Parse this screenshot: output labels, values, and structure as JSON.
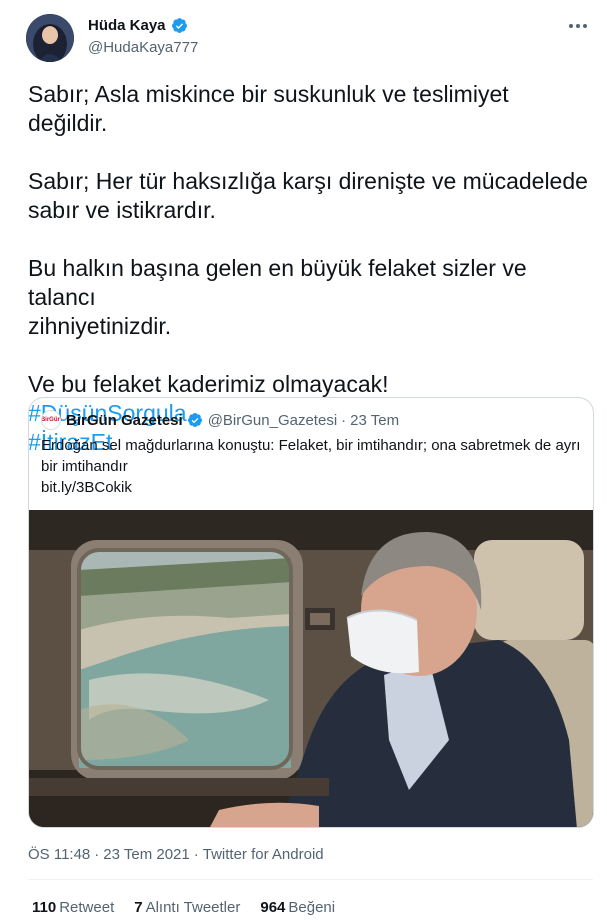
{
  "author": {
    "name": "Hüda Kaya",
    "handle": "@HudaKaya777",
    "verified": true,
    "avatar_icon": "profile-photo-icon"
  },
  "tweet": {
    "paragraphs": [
      "Sabır; Asla miskince bir suskunluk ve teslimiyet değildir.",
      "Sabır; Her tür haksızlığa karşı direnişte ve mücadelede\nsabır ve istikrardır.",
      "Bu halkın başına gelen en büyük felaket sizler ve talancı\nzihniyetinizdir.",
      "Ve bu felaket kaderimiz olmayacak!"
    ],
    "hashtags": [
      "#DüşünSorgula",
      "#İtirazEt"
    ]
  },
  "quote": {
    "name": "BirGün Gazetesi",
    "handle": "@BirGun_Gazetesi",
    "separator": "·",
    "date": "23 Tem",
    "avatar_text": "BirGün",
    "text": "Erdoğan sel mağdurlarına konuştu: Felaket, bir imtihandır; ona sabretmek de ayrı\nbir imtihandır",
    "link": "bit.ly/3BCokik"
  },
  "meta": {
    "time": "ÖS 11:48",
    "sep1": "·",
    "date": "23 Tem 2021",
    "sep2": "·",
    "source": "Twitter for Android"
  },
  "stats": {
    "retweets": "110",
    "retweets_label": "Retweet",
    "quotes": "7",
    "quotes_label": "Alıntı Tweetler",
    "likes": "964",
    "likes_label": "Beğeni"
  },
  "colors": {
    "link": "#1d9bf0",
    "secondary_text": "#536471",
    "primary_text": "#0f1419",
    "border": "#cfd9de"
  }
}
